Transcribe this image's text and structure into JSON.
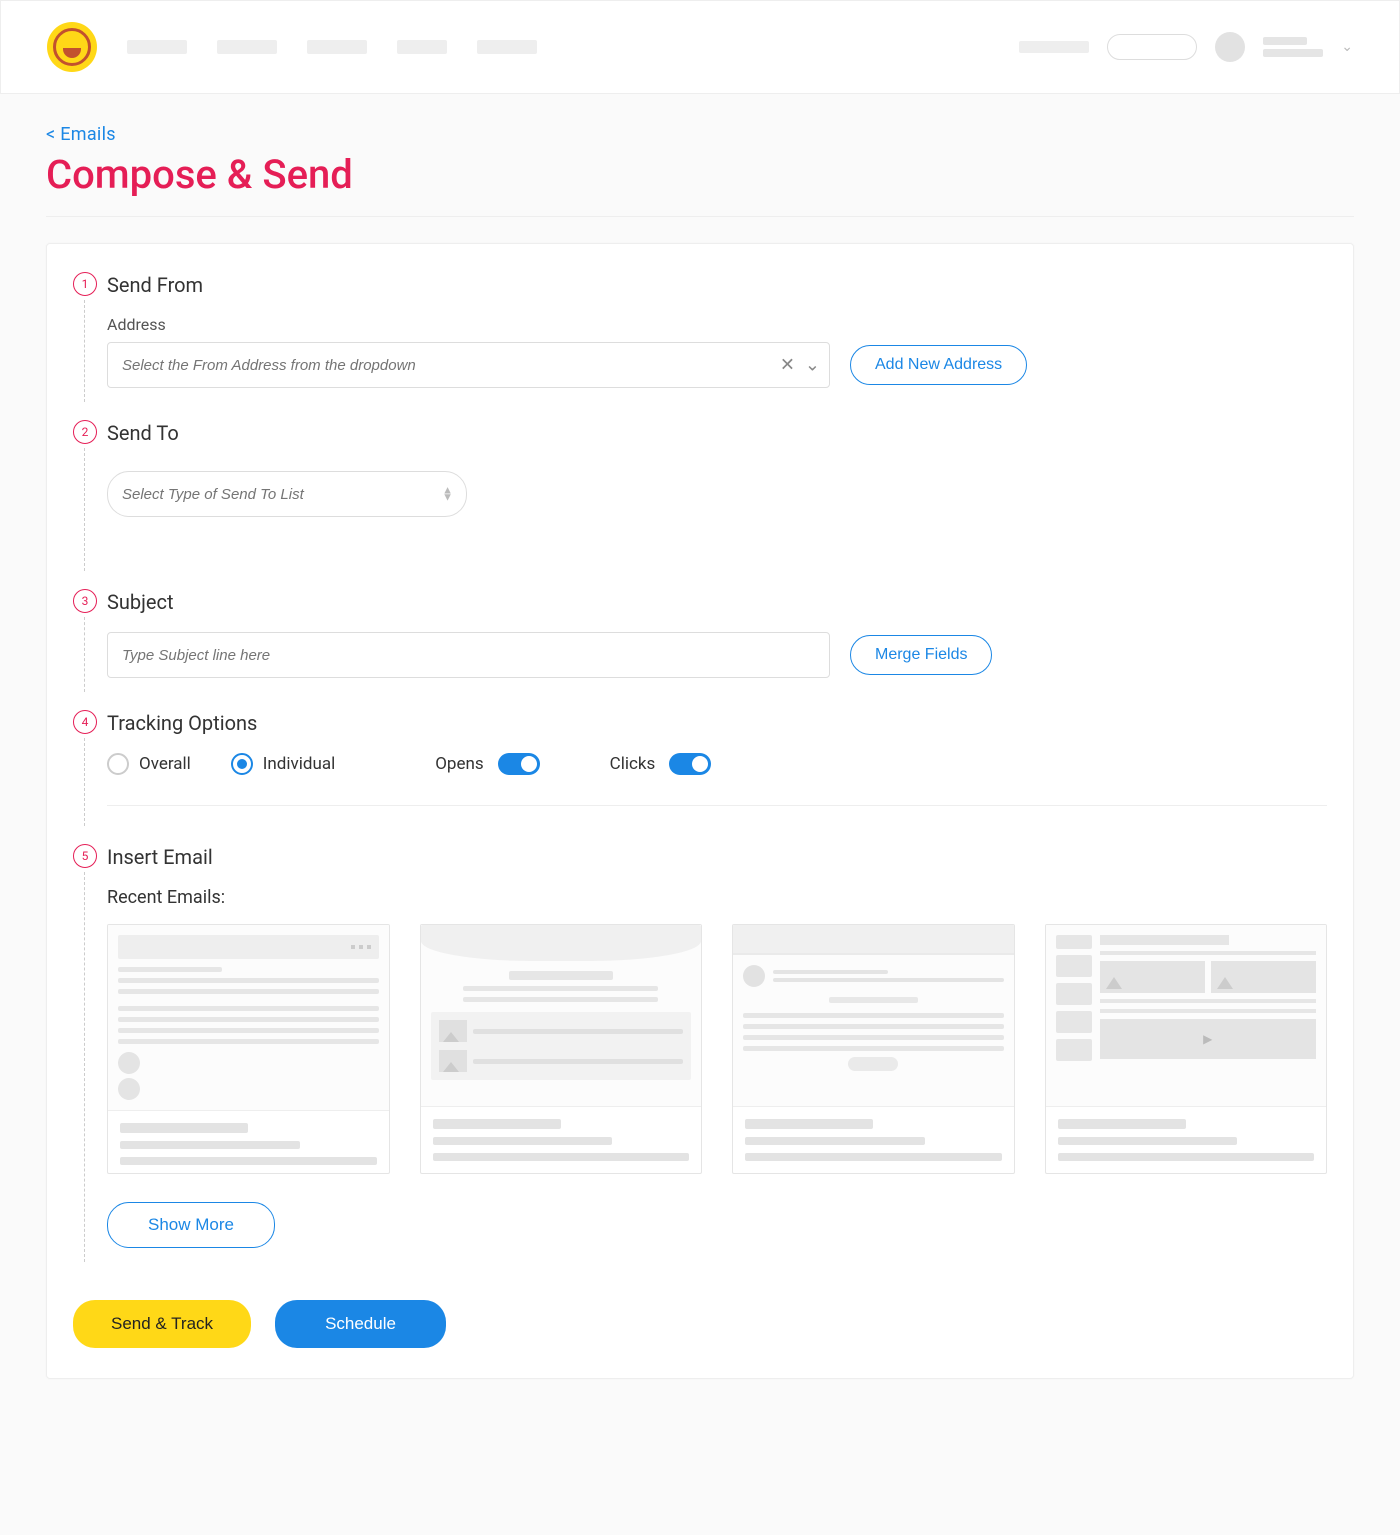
{
  "breadcrumb": {
    "back_label": "< Emails"
  },
  "page": {
    "title": "Compose & Send"
  },
  "colors": {
    "accent_pink": "#e51e56",
    "accent_blue": "#1b87e5",
    "accent_yellow": "#ffd817"
  },
  "steps": {
    "send_from": {
      "number": "1",
      "title": "Send From",
      "field_label": "Address",
      "placeholder": "Select the From Address from the dropdown",
      "add_button": "Add New Address"
    },
    "send_to": {
      "number": "2",
      "title": "Send To",
      "placeholder": "Select Type of Send To List"
    },
    "subject": {
      "number": "3",
      "title": "Subject",
      "placeholder": "Type Subject line here",
      "merge_button": "Merge Fields"
    },
    "tracking": {
      "number": "4",
      "title": "Tracking Options",
      "radio_overall": "Overall",
      "radio_individual": "Individual",
      "selected_radio": "individual",
      "toggle_opens_label": "Opens",
      "toggle_opens_on": true,
      "toggle_clicks_label": "Clicks",
      "toggle_clicks_on": true
    },
    "insert": {
      "number": "5",
      "title": "Insert Email",
      "recent_label": "Recent Emails:",
      "show_more": "Show More"
    }
  },
  "actions": {
    "send_track": "Send & Track",
    "schedule": "Schedule"
  }
}
